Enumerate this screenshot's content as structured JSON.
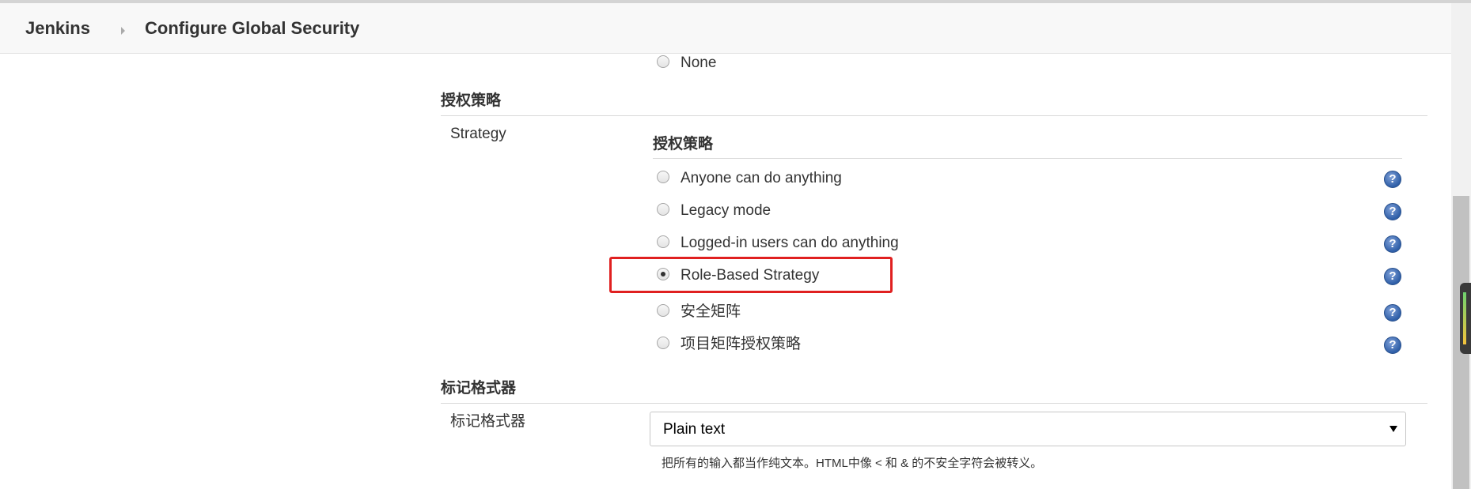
{
  "breadcrumb": {
    "root": "Jenkins",
    "current": "Configure Global Security"
  },
  "security_realm": {
    "none_option": "None",
    "none_checked": false
  },
  "authorization": {
    "section_title": "授权策略",
    "field_label": "Strategy",
    "inner_title": "授权策略",
    "options": [
      {
        "label": "Anyone can do anything",
        "checked": false
      },
      {
        "label": "Legacy mode",
        "checked": false
      },
      {
        "label": "Logged-in users can do anything",
        "checked": false
      },
      {
        "label": "Role-Based Strategy",
        "checked": true
      },
      {
        "label": "安全矩阵",
        "checked": false
      },
      {
        "label": "项目矩阵授权策略",
        "checked": false
      }
    ],
    "help_symbol": "?"
  },
  "markup_formatter": {
    "section_title": "标记格式器",
    "field_label": "标记格式器",
    "selected_value": "Plain text",
    "hint": "把所有的输入都当作纯文本。HTML中像 < 和 & 的不安全字符会被转义。"
  },
  "colors": {
    "highlight": "#e02020",
    "help_icon": "#2f5fa8",
    "breadcrumb_bg": "#f8f8f8"
  },
  "icons": {
    "help": "help-icon",
    "breadcrumb_separator": "chevron-right-icon",
    "select_arrow": "chevron-down-icon"
  }
}
